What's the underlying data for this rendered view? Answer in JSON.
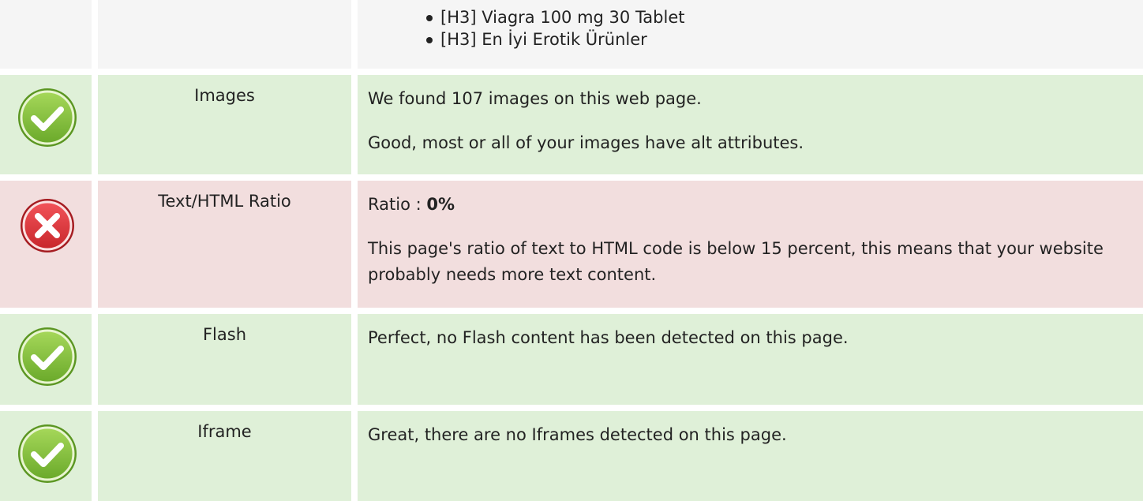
{
  "headings_row": {
    "items": [
      "[H3] Viagra 100 mg 30 Tablet",
      "[H3] En İyi Erotik Ürünler"
    ]
  },
  "images": {
    "label": "Images",
    "status": "pass",
    "line1": "We found 107 images on this web page.",
    "line2": "Good, most or all of your images have alt attributes."
  },
  "text_ratio": {
    "label": "Text/HTML Ratio",
    "status": "fail",
    "ratio_prefix": "Ratio : ",
    "ratio_value": "0%",
    "line2": "This page's ratio of text to HTML code is below 15 percent, this means that your website probably needs more text content."
  },
  "flash": {
    "label": "Flash",
    "status": "pass",
    "line1": "Perfect, no Flash content has been detected on this page."
  },
  "iframe": {
    "label": "Iframe",
    "status": "pass",
    "line1": "Great, there are no Iframes detected on this page."
  },
  "colors": {
    "pass_bg": "#dff0d8",
    "fail_bg": "#f2dede",
    "neutral_bg": "#f5f5f5",
    "check_icon": "#8cc63f",
    "error_icon": "#e0393e"
  }
}
